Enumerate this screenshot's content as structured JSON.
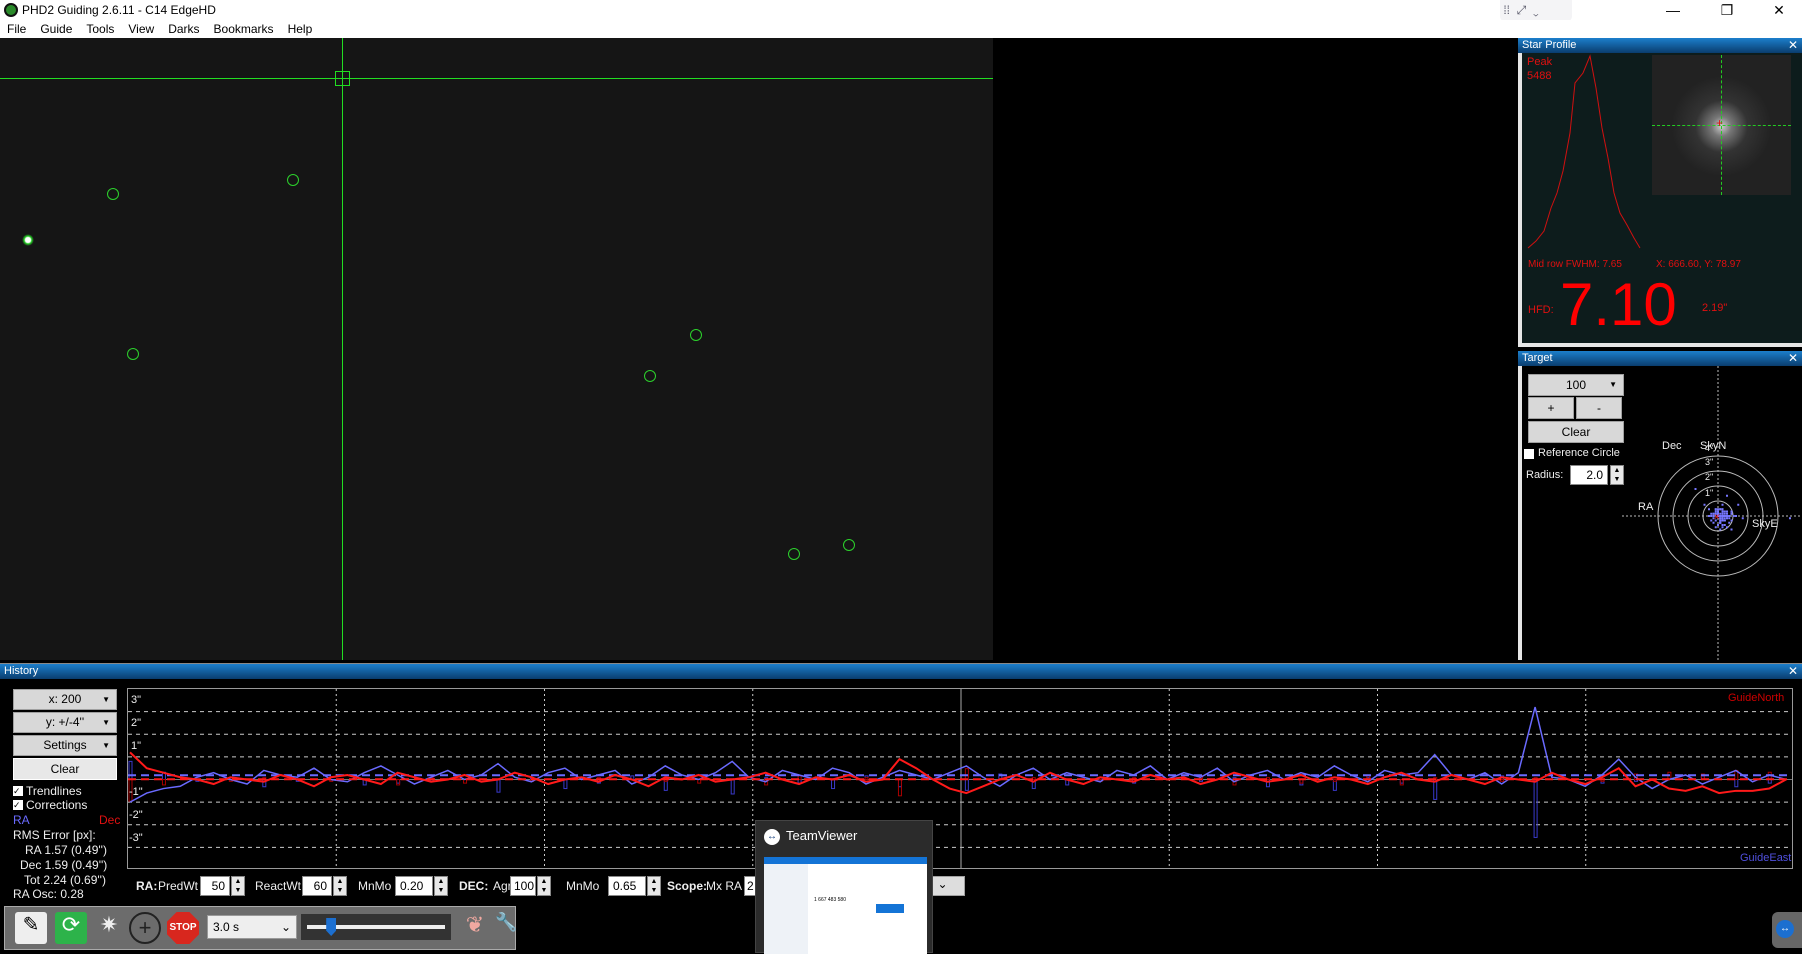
{
  "window": {
    "title": "PHD2 Guiding 2.6.11 - C14 EdgeHD",
    "minimize": "—",
    "restore": "❐",
    "close": "✕"
  },
  "menu": [
    "File",
    "Guide",
    "Tools",
    "View",
    "Darks",
    "Bookmarks",
    "Help"
  ],
  "star_profile": {
    "title": "Star Profile",
    "peak_label": "Peak",
    "peak_value": "5488",
    "fwhm": "Mid row FWHM: 7.65",
    "position": "X: 666.60, Y: 78.97",
    "hfd_label": "HFD:",
    "hfd_value": "7.10",
    "hfd_arcsec": "2.19\"",
    "close": "✕"
  },
  "target": {
    "title": "Target",
    "length_select": "100",
    "plus": "+",
    "minus": "-",
    "clear": "Clear",
    "reference_circle": "Reference Circle",
    "reference_checked": false,
    "radius_label": "Radius:",
    "radius_value": "2.0",
    "dec_label": "Dec",
    "skyn": "SkyN",
    "ra_label": "RA",
    "skye": "SkyE",
    "ring_labels": [
      "1\"",
      "2\"",
      "3\"",
      "4\""
    ],
    "close": "✕"
  },
  "history": {
    "title": "History",
    "close": "✕",
    "x_select": "x: 200",
    "y_select": "y: +/-4''",
    "settings": "Settings",
    "clear": "Clear",
    "trendlines": "Trendlines",
    "trendlines_checked": true,
    "corrections": "Corrections",
    "corrections_checked": true,
    "ra_legend": "RA",
    "dec_legend": "Dec",
    "rms_title": "RMS Error [px]:",
    "rms_ra": "RA  1.57 (0.49'')",
    "rms_dec": "Dec  1.59 (0.49'')",
    "rms_tot": "Tot  2.24 (0.69'')",
    "ra_osc": "RA Osc: 0.28",
    "guide_north": "GuideNorth",
    "guide_east": "GuideEast",
    "y_ticks": [
      "3\"",
      "2\"",
      "1\"",
      "-1\"",
      "-2\"",
      "-3\""
    ],
    "colors": {
      "ra": "#6a6aff",
      "dec": "#ff1a1a"
    },
    "ylim": [
      -4,
      4
    ],
    "ra": [
      -1.0,
      -0.6,
      -0.4,
      -0.3,
      0.1,
      0.3,
      0.0,
      -0.2,
      0.4,
      0.2,
      0.1,
      0.5,
      0.0,
      -0.1,
      0.3,
      0.6,
      0.2,
      -0.2,
      0.1,
      0.4,
      0.0,
      0.2,
      0.7,
      0.1,
      -0.1,
      0.3,
      0.5,
      0.0,
      0.2,
      0.4,
      -0.2,
      0.1,
      0.6,
      0.2,
      0.0,
      0.3,
      0.8,
      0.1,
      -0.1,
      0.4,
      0.2,
      0.0,
      0.5,
      0.3,
      -0.2,
      0.1,
      0.4,
      0.2,
      0.0,
      0.3,
      0.6,
      0.1,
      -0.3,
      0.2,
      0.5,
      0.0,
      0.3,
      0.1,
      -0.1,
      0.4,
      0.2,
      0.6,
      0.0,
      0.3,
      0.1,
      0.5,
      -0.1,
      0.2,
      0.4,
      0.0,
      0.3,
      0.1,
      0.6,
      0.2,
      -0.1,
      0.4,
      0.2,
      0.3,
      1.1,
      0.2,
      0.0,
      0.3,
      -0.2,
      0.3,
      3.2,
      0.1,
      0.0,
      -0.3,
      0.2,
      0.9,
      0.1,
      -0.4,
      0.0,
      0.2,
      -0.2,
      0.1,
      0.4,
      -0.1,
      0.2,
      0.0
    ],
    "dec": [
      1.2,
      0.5,
      0.3,
      0.1,
      0.0,
      -0.2,
      0.1,
      0.0,
      -0.1,
      0.2,
      0.0,
      -0.3,
      0.1,
      0.2,
      0.0,
      -0.2,
      0.3,
      0.1,
      -0.1,
      0.0,
      0.2,
      -0.1,
      0.0,
      0.3,
      0.1,
      -0.2,
      0.0,
      0.1,
      -0.1,
      0.2,
      0.0,
      -0.3,
      0.1,
      0.0,
      0.2,
      -0.1,
      0.0,
      0.1,
      0.3,
      0.0,
      -0.2,
      0.1,
      0.0,
      0.2,
      -0.1,
      0.0,
      0.9,
      0.5,
      0.0,
      -0.4,
      -0.6,
      -0.3,
      0.0,
      0.2,
      -0.1,
      0.3,
      0.0,
      -0.2,
      0.1,
      0.0,
      -0.1,
      0.2,
      0.0,
      0.1,
      -0.2,
      0.0,
      0.3,
      0.1,
      -0.1,
      0.0,
      0.2,
      -0.1,
      0.1,
      0.0,
      -0.2,
      0.1,
      0.3,
      0.0,
      -0.1,
      0.2,
      0.0,
      -0.2,
      0.1,
      0.0,
      -0.1,
      0.3,
      0.0,
      -0.2,
      0.1,
      0.5,
      -0.3,
      0.0,
      -0.4,
      -0.5,
      -0.3,
      -0.6,
      -0.5,
      -0.5,
      -0.4,
      0.0
    ]
  },
  "params": {
    "ra_label": "RA:",
    "predwt_label": "PredWt",
    "predwt": "50",
    "reactwt_label": "ReactWt",
    "reactwt": "60",
    "mnmo_label": "MnMo",
    "ra_mnmo": "0.20",
    "dec_label": "DEC:",
    "agr_label": "Agr",
    "agr": "100",
    "dec_mnmo": "0.65",
    "scope_label": "Scope:",
    "mxra_label": "Mx RA",
    "mxra": "2"
  },
  "toolbar": {
    "exposure": "3.0 s",
    "exposure_slider": 0.15
  },
  "teamviewer": {
    "title": "TeamViewer",
    "id": "1 667 483 580"
  }
}
